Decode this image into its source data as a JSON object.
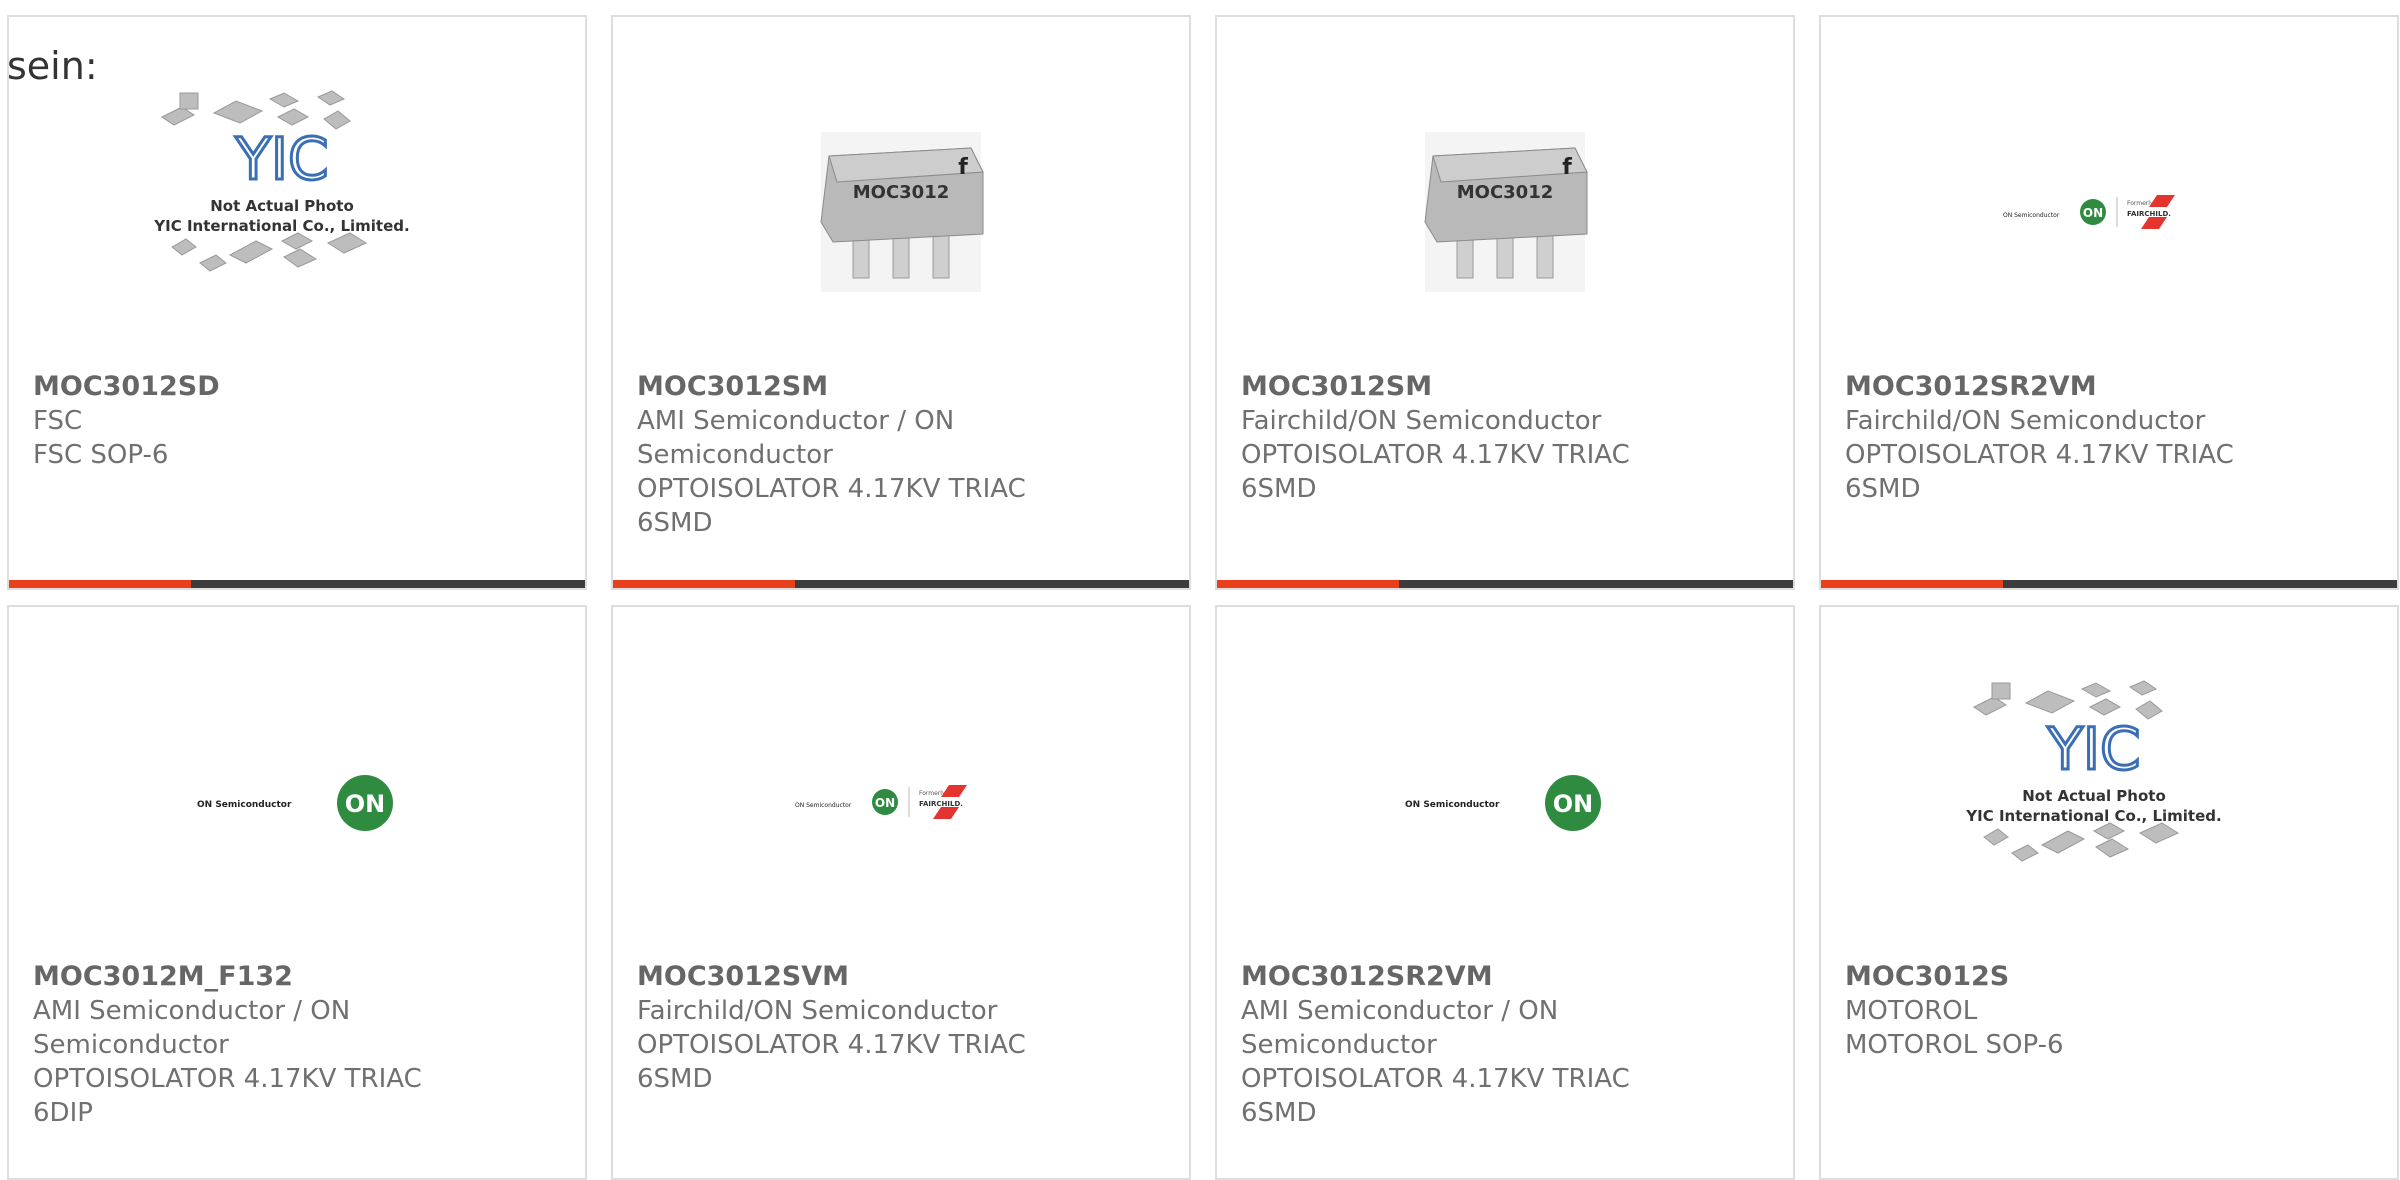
{
  "page": {
    "prefix_text": "sein:"
  },
  "colors": {
    "accent": "#e8401c",
    "bar": "#3c3c3c",
    "border": "#dddddd",
    "on_green": "#2e8b3f",
    "fairchild_red": "#e3342f",
    "yic_blue": "#3a6fb5"
  },
  "placeholder": {
    "line1": "Not Actual Photo",
    "line2": "YIC International Co., Limited.",
    "logo": "YIC"
  },
  "chip": {
    "marking": "MOC3012"
  },
  "onlogo": {
    "wordmark": "ON Semiconductor",
    "badge": "ON",
    "formerly": "Formerly",
    "fairchild": "FAIRCHILD."
  },
  "products": [
    {
      "part": "MOC3012SD",
      "mfr": "FSC",
      "desc": "FSC SOP-6",
      "image": "placeholder-photo"
    },
    {
      "part": "MOC3012SM",
      "mfr": "AMI Semiconductor / ON Semiconductor",
      "desc": "OPTOISOLATOR 4.17KV TRIAC 6SMD",
      "image": "chip-photo"
    },
    {
      "part": "MOC3012SM",
      "mfr": "Fairchild/ON Semiconductor",
      "desc": "OPTOISOLATOR 4.17KV TRIAC 6SMD",
      "image": "chip-photo"
    },
    {
      "part": "MOC3012SR2VM",
      "mfr": "Fairchild/ON Semiconductor",
      "desc": "OPTOISOLATOR 4.17KV TRIAC 6SMD",
      "image": "on-fairchild-logo"
    },
    {
      "part": "MOC3012M_F132",
      "mfr": "AMI Semiconductor / ON Semiconductor",
      "desc": "OPTOISOLATOR 4.17KV TRIAC 6DIP",
      "image": "on-logo"
    },
    {
      "part": "MOC3012SVM",
      "mfr": "Fairchild/ON Semiconductor",
      "desc": "OPTOISOLATOR 4.17KV TRIAC 6SMD",
      "image": "on-fairchild-logo"
    },
    {
      "part": "MOC3012SR2VM",
      "mfr": "AMI Semiconductor / ON Semiconductor",
      "desc": "OPTOISOLATOR 4.17KV TRIAC 6SMD",
      "image": "on-logo"
    },
    {
      "part": "MOC3012S",
      "mfr": "MOTOROL",
      "desc": "MOTOROL SOP-6",
      "image": "placeholder-photo"
    }
  ]
}
